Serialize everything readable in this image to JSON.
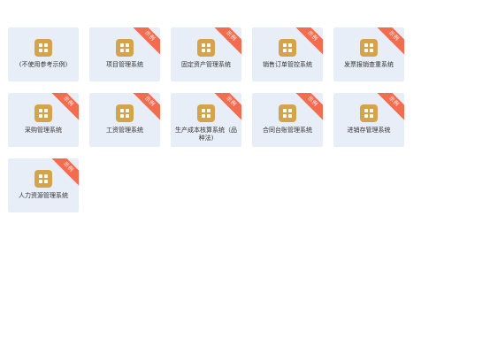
{
  "tiles": [
    {
      "label": "(不使用参考示例)",
      "badge": ""
    },
    {
      "label": "项目管理系统",
      "badge": "示例"
    },
    {
      "label": "固定资产管理系统",
      "badge": "示例"
    },
    {
      "label": "销售订单管控系统",
      "badge": "示例"
    },
    {
      "label": "发票报销查重系统",
      "badge": "示例"
    },
    {
      "label": "采购管理系统",
      "badge": "示例"
    },
    {
      "label": "工资管理系统",
      "badge": "示例"
    },
    {
      "label": "生产成本核算系统（品种法)",
      "badge": "示例"
    },
    {
      "label": "合同台账管理系统",
      "badge": "示例"
    },
    {
      "label": "进销存管理系统",
      "badge": "示例"
    },
    {
      "label": "人力资源管理系统",
      "badge": "示例"
    }
  ],
  "icon": "app-grid-icon",
  "colors": {
    "tile_bg": "#e7eef8",
    "icon_bg": "#d5a34b",
    "ribbon_bg": "#f26c4f",
    "label_text": "#333333"
  }
}
